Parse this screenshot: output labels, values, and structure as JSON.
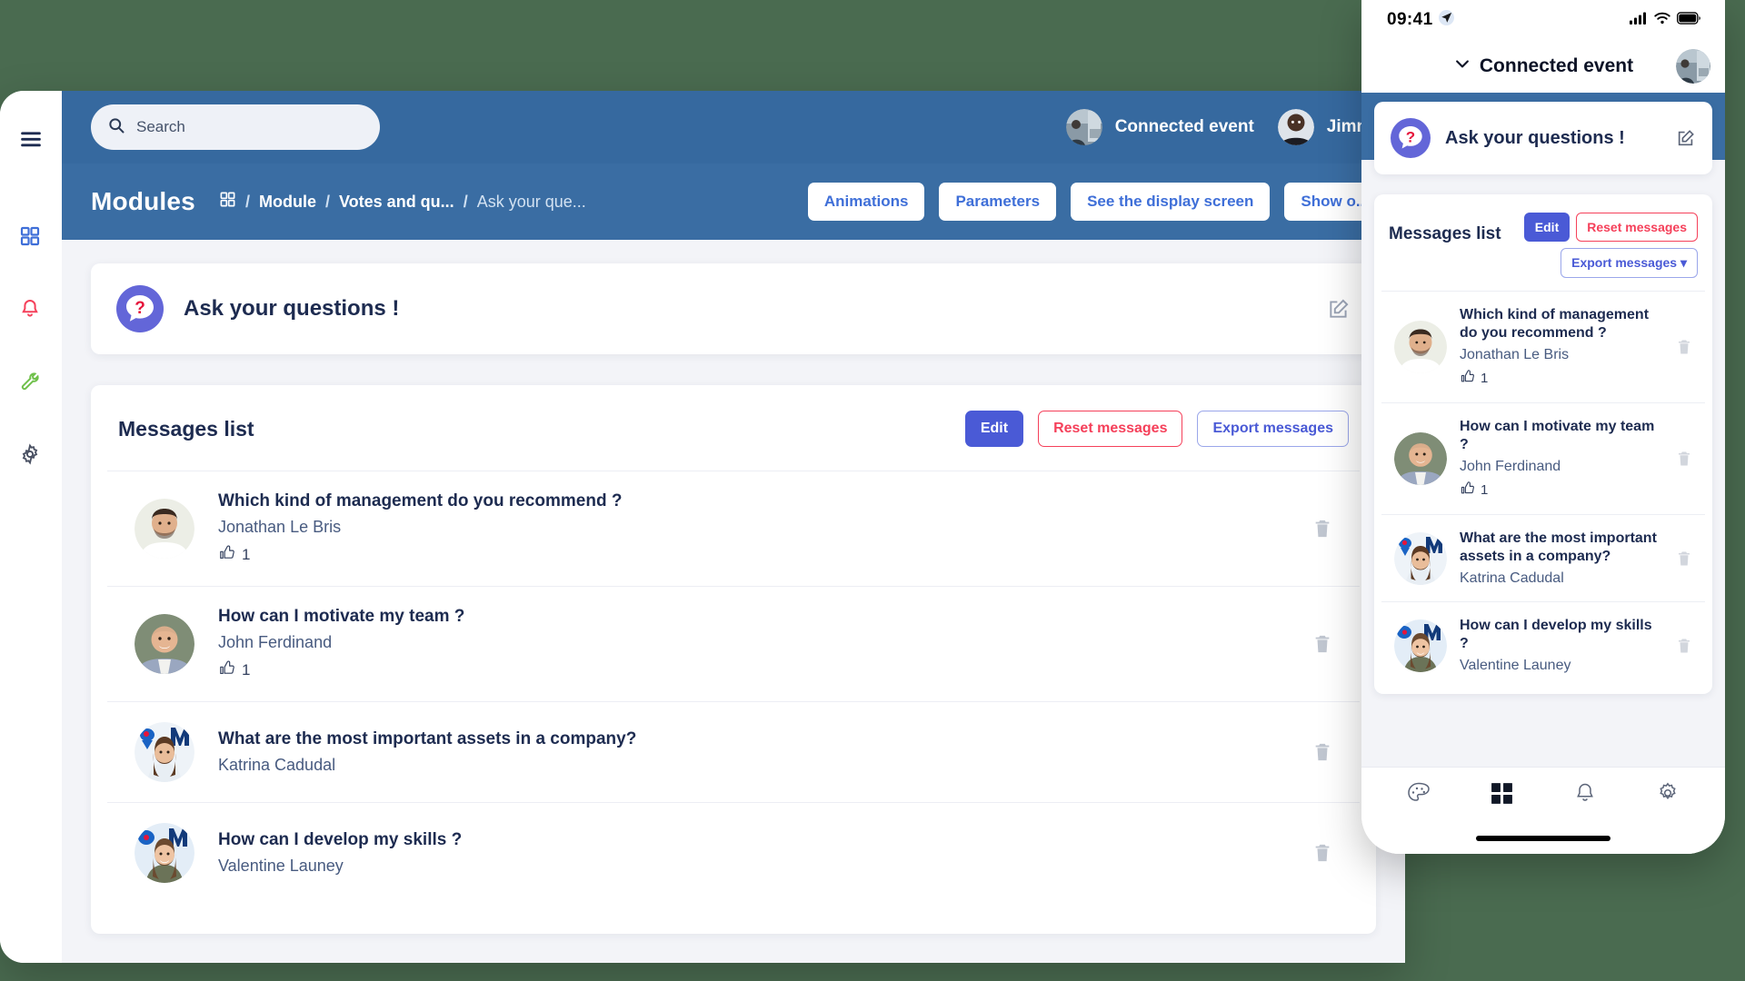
{
  "theme": {
    "page_background": "#4a6b50",
    "topbar_blue": "#36699f",
    "breadcrumb_blue": "#3a6da3",
    "primary": "#4a5ad6",
    "danger": "#f5405a",
    "badge_purple": "#6366d8",
    "badge_question_mark": "#e5153b"
  },
  "desktop": {
    "sidebar": {
      "items": [
        {
          "icon": "hamburger-menu-icon",
          "color": "#1d2b50"
        },
        {
          "icon": "grid-modules-icon",
          "color": "#3f6fd8"
        },
        {
          "icon": "bell-notifications-icon",
          "color": "#f5405a"
        },
        {
          "icon": "wrench-tools-icon",
          "color": "#6fc04a"
        },
        {
          "icon": "gear-settings-icon",
          "color": "#4a5163"
        }
      ]
    },
    "topbar": {
      "search": {
        "value": "",
        "placeholder": "Search",
        "icon": "search-icon"
      },
      "event_chip": {
        "label": "Connected event",
        "avatar": "event-avatar"
      },
      "user_chip": {
        "label": "Jimmy",
        "avatar": "user-avatar"
      }
    },
    "breadcrumb_bar": {
      "title": "Modules",
      "home_icon": "grid-home-icon",
      "crumbs": [
        "Module",
        "Votes and qu...",
        "Ask your que..."
      ],
      "separator": "/",
      "actions": [
        "Animations",
        "Parameters",
        "See the display screen",
        "Show o..."
      ]
    },
    "ask_card": {
      "title": "Ask your questions !",
      "badge_icon": "question-bubble-icon",
      "edit_icon": "edit-pencil-icon"
    },
    "messages_card": {
      "title": "Messages list",
      "buttons": {
        "edit": "Edit",
        "reset": "Reset messages",
        "export": "Export messages"
      },
      "rows": [
        {
          "question": "Which kind of management do you recommend ?",
          "author": "Jonathan Le Bris",
          "likes": "1",
          "avatar": "avatar-jonathan",
          "delete_icon": "trash-icon"
        },
        {
          "question": "How can I motivate my team ?",
          "author": "John Ferdinand",
          "likes": "1",
          "avatar": "avatar-john",
          "delete_icon": "trash-icon"
        },
        {
          "question": "What are the most important assets in a company?",
          "author": "Katrina Cadudal",
          "likes": "",
          "avatar": "avatar-katrina",
          "delete_icon": "trash-icon"
        },
        {
          "question": "How can I develop my skills ?",
          "author": "Valentine Launey",
          "likes": "",
          "avatar": "avatar-valentine",
          "delete_icon": "trash-icon"
        }
      ]
    }
  },
  "phone": {
    "status_bar": {
      "time": "09:41",
      "location_icon": "location-arrow-icon",
      "cellular_icon": "cellular-signal-icon",
      "wifi_icon": "wifi-icon",
      "battery_icon": "battery-full-icon"
    },
    "header": {
      "title": "Connected event",
      "chevron_icon": "chevron-down-icon",
      "avatar": "event-avatar"
    },
    "ask_card": {
      "title": "Ask your questions !",
      "badge_icon": "question-bubble-icon",
      "edit_icon": "edit-pencil-icon"
    },
    "messages_card": {
      "title": "Messages list",
      "buttons": {
        "edit": "Edit",
        "reset": "Reset messages",
        "export": "Export messages"
      },
      "rows": [
        {
          "question": "Which kind of management do you recommend ?",
          "author": "Jonathan Le Bris",
          "likes": "1",
          "avatar": "avatar-jonathan",
          "delete_icon": "trash-icon"
        },
        {
          "question": "How can I motivate my team ?",
          "author": "John Ferdinand",
          "likes": "1",
          "avatar": "avatar-john",
          "delete_icon": "trash-icon"
        },
        {
          "question": "What are the most important assets in a company?",
          "author": "Katrina Cadudal",
          "likes": "",
          "avatar": "avatar-katrina",
          "delete_icon": "trash-icon"
        },
        {
          "question": "How can I develop my skills ?",
          "author": "Valentine Launey",
          "likes": "",
          "avatar": "avatar-valentine",
          "delete_icon": "trash-icon"
        }
      ]
    },
    "bottom_nav": [
      {
        "icon": "palette-icon",
        "active": false
      },
      {
        "icon": "grid-modules-icon",
        "active": true
      },
      {
        "icon": "bell-notifications-icon",
        "active": false
      },
      {
        "icon": "gear-settings-icon",
        "active": false
      }
    ]
  }
}
